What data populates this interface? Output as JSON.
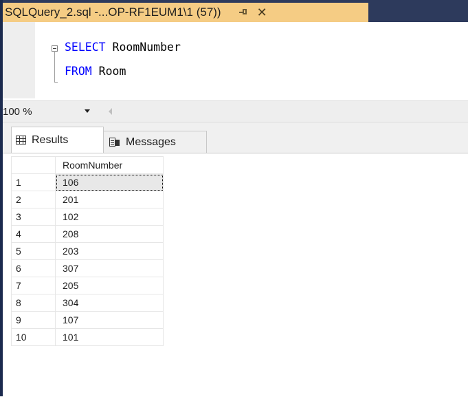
{
  "tab": {
    "title": "SQLQuery_2.sql -...OP-RF1EUM1\\1 (57))",
    "pin_icon": "pin-icon",
    "close_icon": "close-icon",
    "close_glyph": "✕"
  },
  "editor": {
    "line1": {
      "keyword": "SELECT",
      "rest": " RoomNumber"
    },
    "line2": {
      "keyword": "FROM",
      "rest": " Room"
    }
  },
  "zoom": {
    "value": "100 %"
  },
  "results_tabs": {
    "results_label": "Results",
    "messages_label": "Messages"
  },
  "grid": {
    "column_header": "RoomNumber",
    "rows": [
      {
        "n": "1",
        "v": "106"
      },
      {
        "n": "2",
        "v": "201"
      },
      {
        "n": "3",
        "v": "102"
      },
      {
        "n": "4",
        "v": "208"
      },
      {
        "n": "5",
        "v": "203"
      },
      {
        "n": "6",
        "v": "307"
      },
      {
        "n": "7",
        "v": "205"
      },
      {
        "n": "8",
        "v": "304"
      },
      {
        "n": "9",
        "v": "107"
      },
      {
        "n": "10",
        "v": "101"
      }
    ]
  },
  "colors": {
    "tab_active": "#f5cc84",
    "frame": "#2d3a5c",
    "keyword": "#0000ff"
  }
}
